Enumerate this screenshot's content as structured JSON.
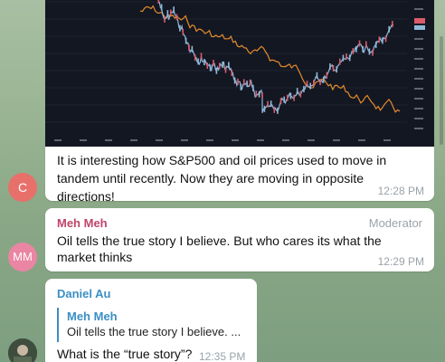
{
  "messages": [
    {
      "text": "It is interesting how S&P500 and oil prices used to move in tandem until recently. Now they are moving in opposite directions!",
      "time": "12:28 PM",
      "avatar": "C",
      "colors": {
        "avatar": "#e8706b"
      }
    },
    {
      "sender": "Meh Meh",
      "role": "Moderator",
      "text": "Oil tells the true story I believe. But who cares its what the market thinks",
      "time": "12:29 PM",
      "avatar": "MM",
      "colors": {
        "sender": "#c0456a",
        "avatar": "#ea85a4"
      }
    },
    {
      "sender": "Daniel Au",
      "reply": {
        "sender": "Meh Meh",
        "text": "Oil tells the true story I believe. ..."
      },
      "text": "What is the “true story”?",
      "time": "12:35 PM",
      "colors": {
        "sender": "#3a8fc4"
      }
    }
  ],
  "chart": {
    "background": "#131722",
    "series_colors": [
      "#e58b2b",
      "#8fb8d8",
      "#d95a6a"
    ]
  }
}
